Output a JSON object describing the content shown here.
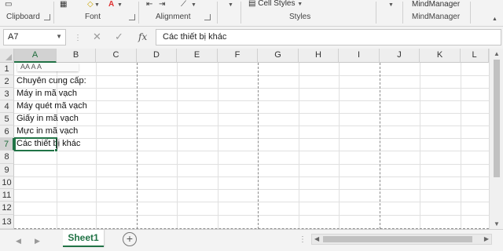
{
  "ribbon": {
    "groups": [
      {
        "label": "Clipboard"
      },
      {
        "label": "Font"
      },
      {
        "label": "Alignment"
      },
      {
        "label": "Styles"
      },
      {
        "label": "MindManager"
      }
    ],
    "cell_styles_label": "Cell Styles",
    "mindmanager_top": "MindManager"
  },
  "formula_bar": {
    "name_box": "A7",
    "fx_label": "fx",
    "formula": "Các thiết bị khác"
  },
  "grid": {
    "columns": [
      "A",
      "B",
      "C",
      "D",
      "E",
      "F",
      "G",
      "H",
      "I",
      "J",
      "K",
      "L"
    ],
    "rows": [
      "1",
      "2",
      "3",
      "4",
      "5",
      "6",
      "7",
      "8",
      "9",
      "10",
      "11",
      "12",
      "13"
    ],
    "selected_column": "A",
    "selected_row": "7",
    "mini_toolbar": "AA  A  A",
    "cells": [
      {
        "ref": "A2",
        "value": "Chuyên cung cấp:"
      },
      {
        "ref": "A3",
        "value": "Máy in mã vạch"
      },
      {
        "ref": "A4",
        "value": "Máy quét mã vạch"
      },
      {
        "ref": "A5",
        "value": "Giấy in mã vạch"
      },
      {
        "ref": "A6",
        "value": "Mực in mã vạch"
      },
      {
        "ref": "A7",
        "value": "Các thiết bị khác"
      }
    ]
  },
  "sheets": {
    "tabs": [
      {
        "label": "Sheet1",
        "active": true
      }
    ],
    "add_label": "+"
  },
  "colors": {
    "accent": "#217346",
    "ribbon_bg": "#f3f3f3",
    "header_bg": "#eeeeee",
    "font_color_red": "#e03030"
  }
}
